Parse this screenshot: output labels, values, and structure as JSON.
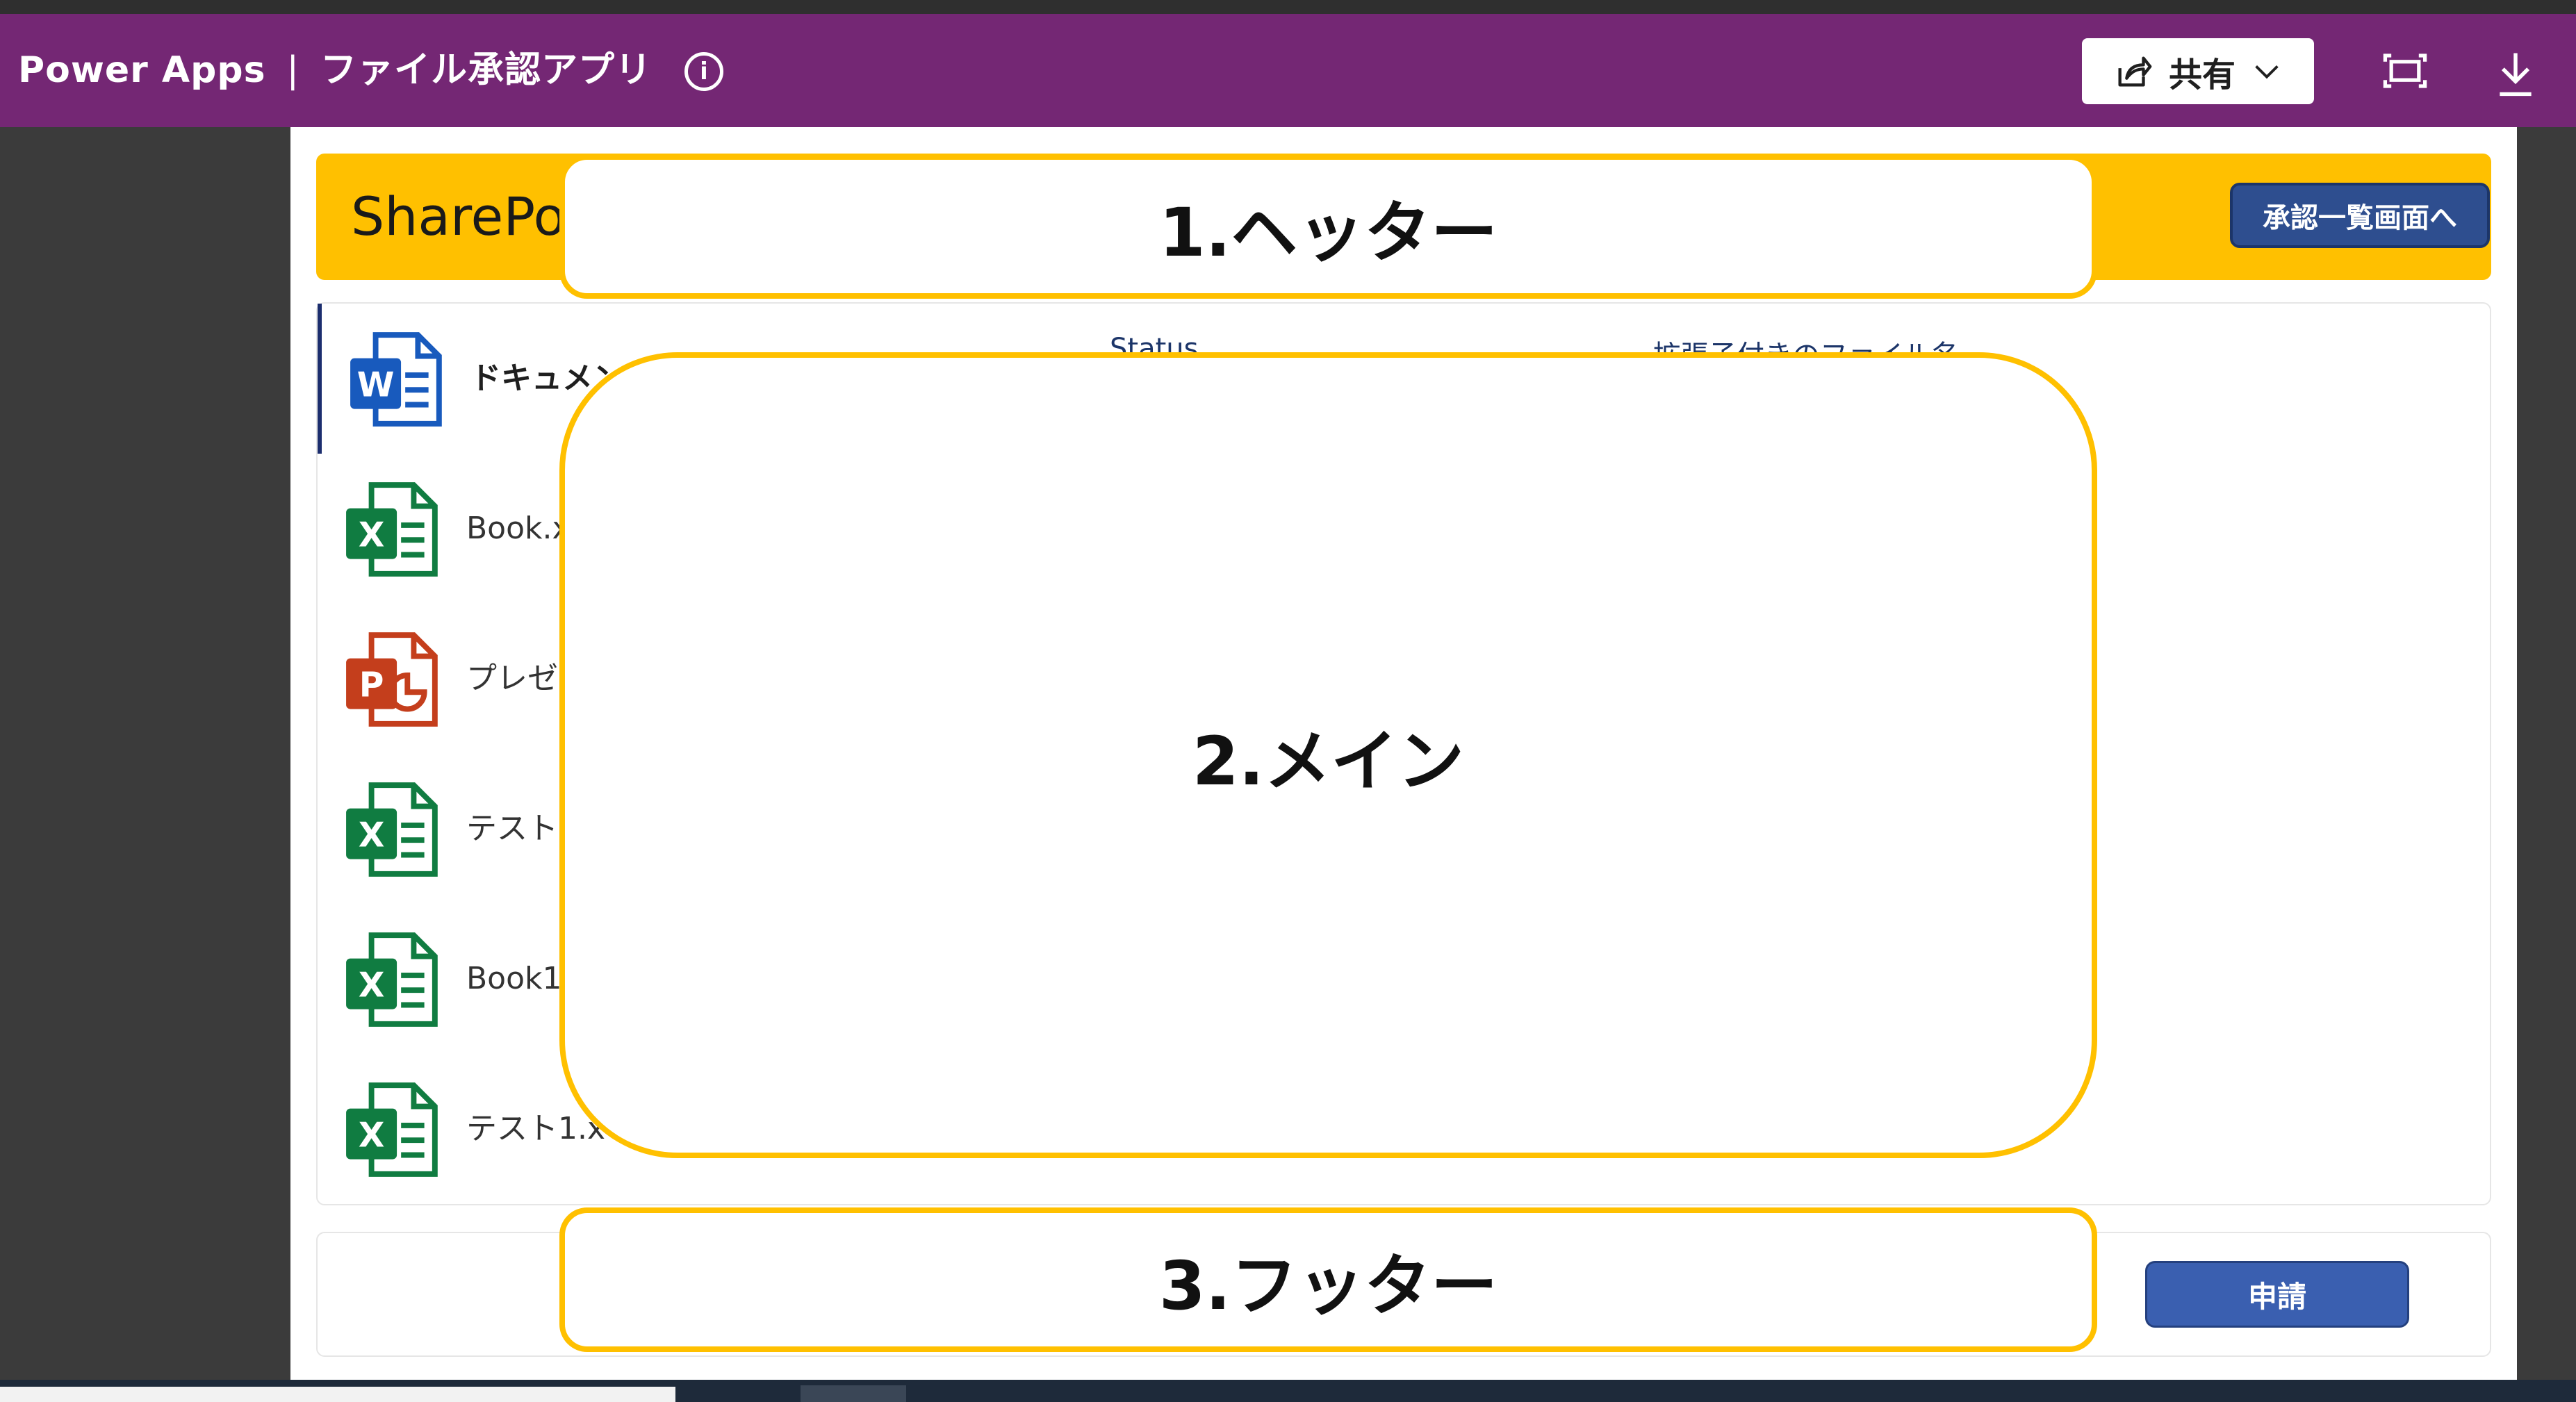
{
  "titlebar": {
    "app_name": "Power Apps",
    "separator": "|",
    "app_title": "ファイル承認アプリ",
    "share_label": "共有"
  },
  "header": {
    "title": "SharePoi",
    "nav_button_label": "承認一覧画面へ"
  },
  "list": {
    "column_status": "Status",
    "column_filename": "拡張子付きのファイル名",
    "items": [
      {
        "name": "ドキュメント",
        "type": "word"
      },
      {
        "name": "Book.x",
        "type": "excel"
      },
      {
        "name": "プレゼ",
        "type": "powerpoint"
      },
      {
        "name": "テスト",
        "type": "excel"
      },
      {
        "name": "Book1",
        "type": "excel"
      },
      {
        "name": "テスト1.x",
        "type": "excel"
      }
    ]
  },
  "footer": {
    "submit_label": "申請"
  },
  "annotations": {
    "header": "1.ヘッター",
    "main": "2.メイン",
    "footer": "3.フッター"
  },
  "colors": {
    "titlebar": "#742774",
    "header": "#ffc000",
    "button": "#2e4e8f",
    "word": "#185abd",
    "excel": "#107c41",
    "powerpoint": "#c43e1c"
  }
}
